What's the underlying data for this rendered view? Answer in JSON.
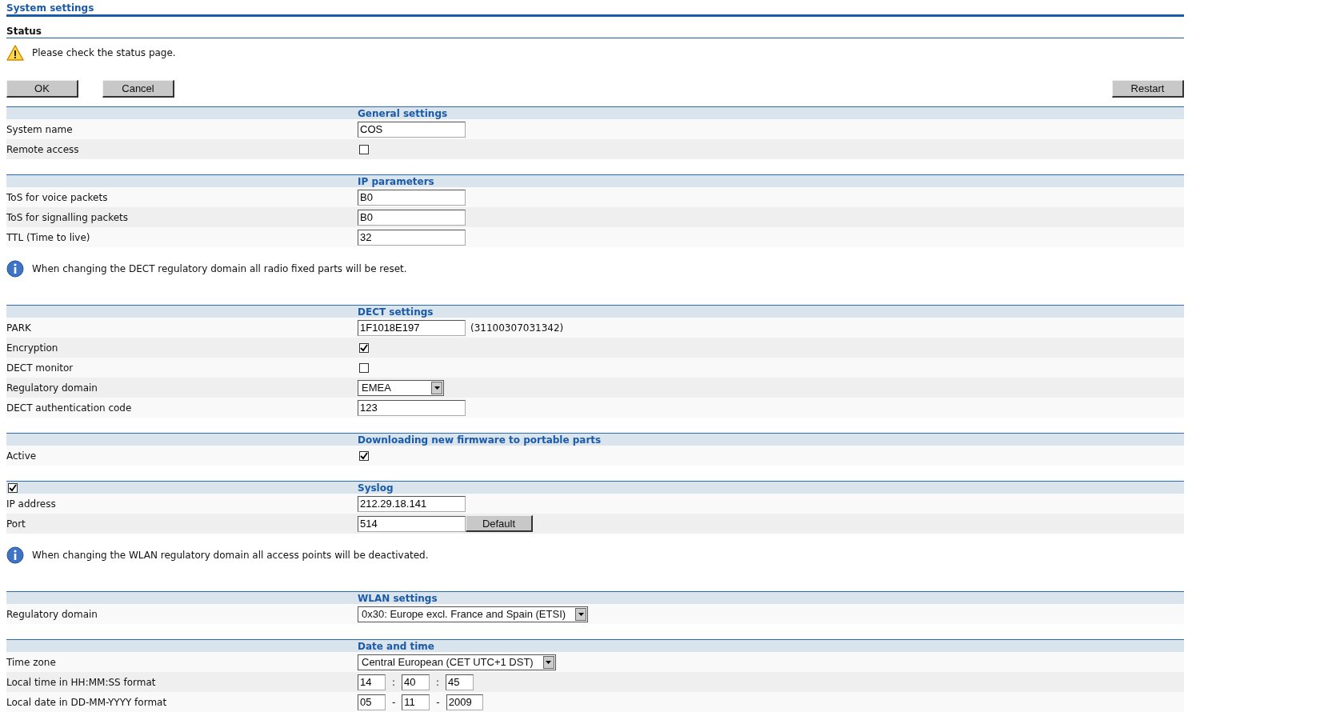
{
  "title": "System settings",
  "status": {
    "heading": "Status",
    "message": "Please check the status page."
  },
  "actions": {
    "left": [
      {
        "label": "OK"
      },
      {
        "label": "Cancel"
      }
    ],
    "right": [
      {
        "label": "Restart"
      }
    ]
  },
  "blocks": [
    {
      "kind": "section",
      "title": "General settings",
      "rows": [
        {
          "kind": "text",
          "label": "System name",
          "value": "COS"
        },
        {
          "kind": "checkbox",
          "label": "Remote access",
          "checked": false
        }
      ]
    },
    {
      "kind": "section",
      "title": "IP parameters",
      "rows": [
        {
          "kind": "text",
          "label": "ToS for voice packets",
          "value": "B0"
        },
        {
          "kind": "text",
          "label": "ToS for signalling packets",
          "value": "B0"
        },
        {
          "kind": "text",
          "label": "TTL (Time to live)",
          "value": "32"
        }
      ]
    },
    {
      "kind": "notice",
      "text": "When changing the DECT regulatory domain all radio fixed parts will be reset."
    },
    {
      "kind": "section",
      "title": "DECT settings",
      "rows": [
        {
          "kind": "text_note",
          "label": "PARK",
          "value": "1F1018E197",
          "note": "(31100307031342)"
        },
        {
          "kind": "checkbox",
          "label": "Encryption",
          "checked": true
        },
        {
          "kind": "checkbox",
          "label": "DECT monitor",
          "checked": false
        },
        {
          "kind": "select",
          "label": "Regulatory domain",
          "value": "EMEA"
        },
        {
          "kind": "text",
          "label": "DECT authentication code",
          "value": "123"
        }
      ]
    },
    {
      "kind": "section",
      "title": "Downloading new firmware to portable parts",
      "rows": [
        {
          "kind": "checkbox",
          "label": "Active",
          "checked": true
        }
      ]
    },
    {
      "kind": "section",
      "title": "Syslog",
      "enabled": true,
      "rows": [
        {
          "kind": "text",
          "label": "IP address",
          "value": "212.29.18.141"
        },
        {
          "kind": "text_button",
          "label": "Port",
          "value": "514",
          "button": "Default"
        }
      ]
    },
    {
      "kind": "notice",
      "text": "When changing the WLAN regulatory domain all access points will be deactivated."
    },
    {
      "kind": "section",
      "title": "WLAN settings",
      "rows": [
        {
          "kind": "select",
          "label": "Regulatory domain",
          "value": "0x30: Europe excl. France and Spain (ETSI)"
        }
      ]
    },
    {
      "kind": "section",
      "title": "Date and time",
      "rows": [
        {
          "kind": "select",
          "label": "Time zone",
          "value": "Central European (CET UTC+1 DST)"
        },
        {
          "kind": "fields",
          "label": "Local time in HH:MM:SS format",
          "values": [
            "14",
            "40",
            "45"
          ],
          "separator": ":"
        },
        {
          "kind": "fields",
          "label": "Local date in DD-MM-YYYY format",
          "values": [
            "05",
            "11",
            "2009"
          ],
          "separator": "-"
        }
      ]
    }
  ]
}
